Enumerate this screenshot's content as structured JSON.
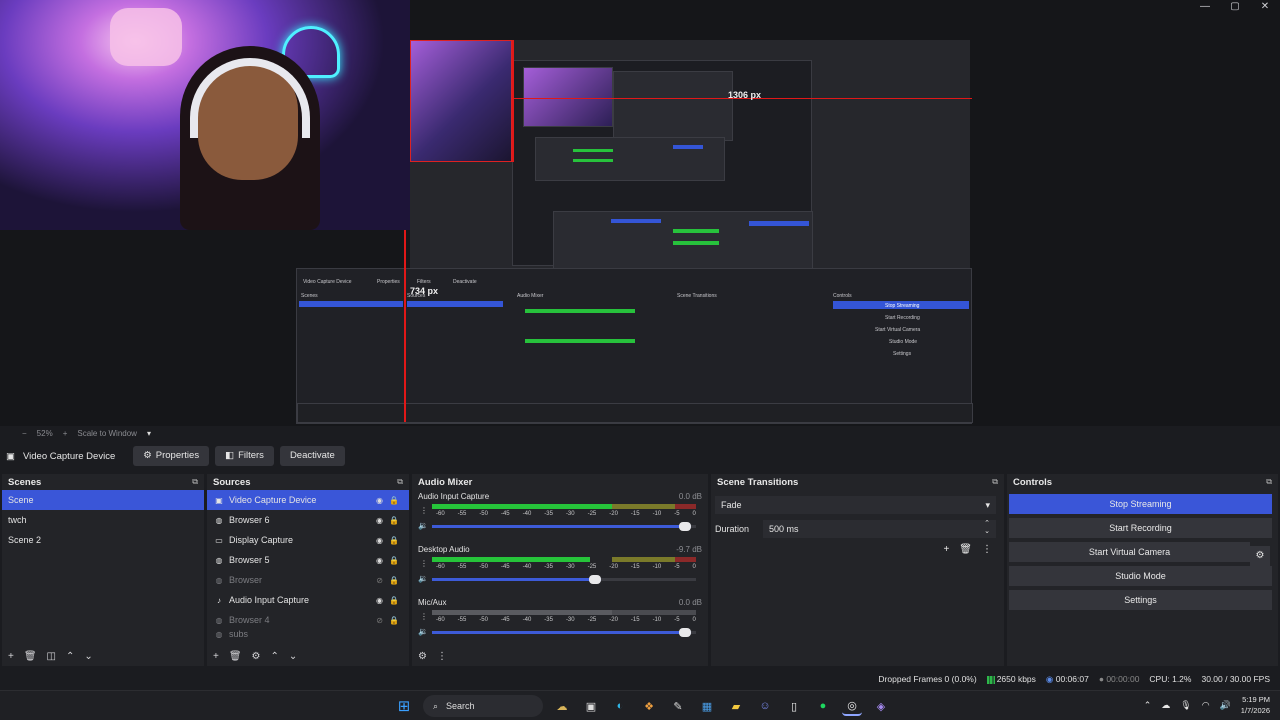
{
  "window": {
    "minimize": "—",
    "maximize": "▢",
    "close": "✕"
  },
  "preview": {
    "measure_horizontal": "1306 px",
    "measure_vertical": "734 px",
    "nested_labels": {
      "sources_tab": "Video Capture Device",
      "properties": "Properties",
      "filters": "Filters",
      "deactivate": "Deactivate",
      "scenes": "Scenes",
      "sources": "Sources",
      "audio_mixer": "Audio Mixer",
      "scene_transitions": "Scene Transitions",
      "controls": "Controls",
      "stop_streaming": "Stop Streaming",
      "start_recording": "Start Recording",
      "start_virtual_camera": "Start Virtual Camera",
      "studio_mode": "Studio Mode",
      "settings": "Settings"
    }
  },
  "zoombar": {
    "zoom": "52%",
    "scale": "Scale to Window"
  },
  "source_toolbar": {
    "selected": "Video Capture Device",
    "properties": "Properties",
    "filters": "Filters",
    "deactivate": "Deactivate"
  },
  "scenes": {
    "title": "Scenes",
    "items": [
      "Scene",
      "twch",
      "Scene 2"
    ],
    "selected_index": 0
  },
  "sources": {
    "title": "Sources",
    "items": [
      {
        "label": "Video Capture Device",
        "icon": "camera-icon",
        "visible": true,
        "selected": true
      },
      {
        "label": "Browser 6",
        "icon": "browser-icon",
        "visible": true
      },
      {
        "label": "Display Capture",
        "icon": "monitor-icon",
        "visible": true
      },
      {
        "label": "Browser 5",
        "icon": "browser-icon",
        "visible": true
      },
      {
        "label": "Browser",
        "icon": "browser-icon",
        "visible": false
      },
      {
        "label": "Audio Input Capture",
        "icon": "mic-icon",
        "visible": true
      },
      {
        "label": "Browser 4",
        "icon": "browser-icon",
        "visible": false
      },
      {
        "label": "subs",
        "icon": "browser-icon",
        "visible": false
      }
    ]
  },
  "mixer": {
    "title": "Audio Mixer",
    "scale": [
      "-60",
      "-55",
      "-50",
      "-45",
      "-40",
      "-35",
      "-30",
      "-25",
      "-20",
      "-15",
      "-10",
      "-5",
      "0"
    ],
    "channels": [
      {
        "name": "Audio Input Capture",
        "db": "0.0 dB",
        "level": 0.68,
        "fader": 0.98
      },
      {
        "name": "Desktop Audio",
        "db": "-9.7 dB",
        "level": 0.6,
        "fader": 0.64
      },
      {
        "name": "Mic/Aux",
        "db": "0.0 dB",
        "level": 0.0,
        "fader": 0.98
      }
    ]
  },
  "transitions": {
    "title": "Scene Transitions",
    "selected": "Fade",
    "duration_label": "Duration",
    "duration_value": "500 ms"
  },
  "controls": {
    "title": "Controls",
    "stop_streaming": "Stop Streaming",
    "start_recording": "Start Recording",
    "start_virtual_camera": "Start Virtual Camera",
    "studio_mode": "Studio Mode",
    "settings": "Settings"
  },
  "status": {
    "dropped": "Dropped Frames 0 (0.0%)",
    "bitrate": "2650 kbps",
    "stream_time": "00:06:07",
    "record_time": "00:00:00",
    "cpu": "CPU: 1.2%",
    "fps": "30.00 / 30.00 FPS"
  },
  "taskbar": {
    "search": "Search",
    "time": "5:19 PM",
    "date": "1/7/2026"
  },
  "colors": {
    "accent": "#3a56d8",
    "meter_green": "#26c43a",
    "dock_bg": "#232428"
  }
}
